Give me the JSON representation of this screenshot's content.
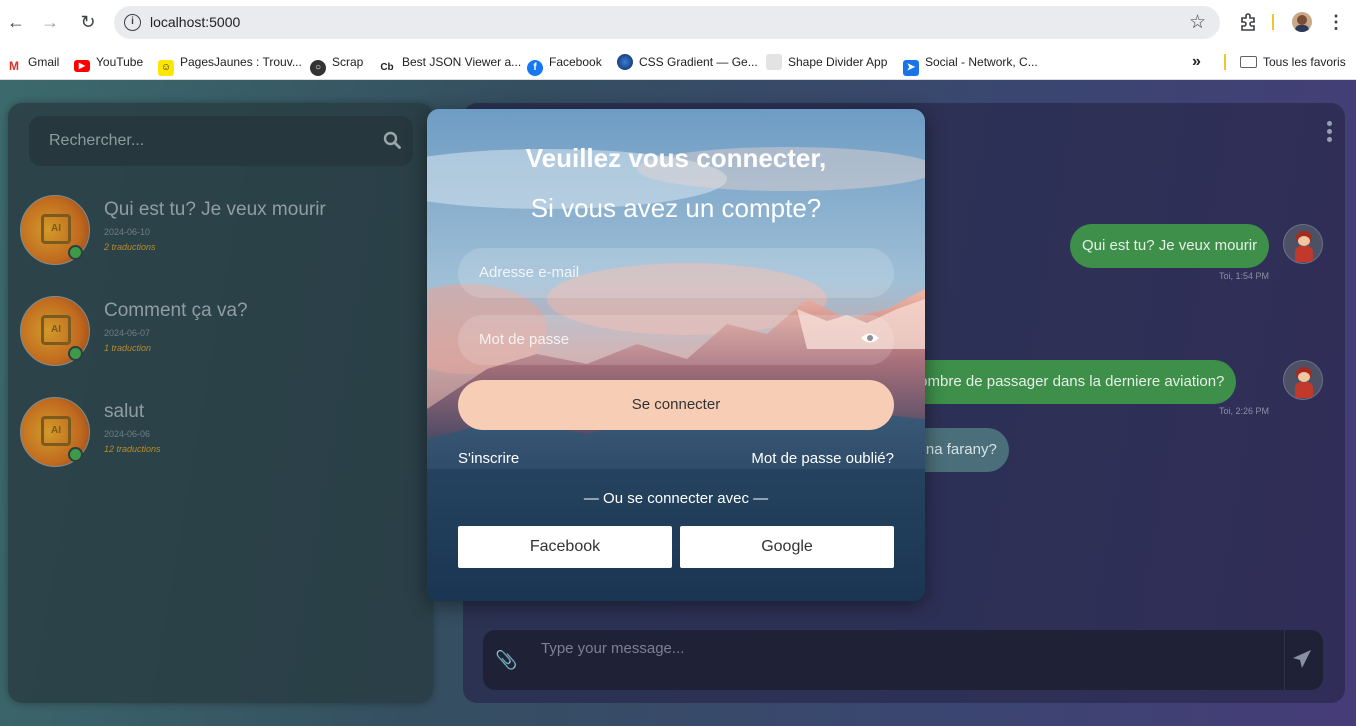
{
  "browser": {
    "url": "localhost:5000",
    "bookmarks": [
      {
        "label": "Gmail",
        "icon": "gmail-icon"
      },
      {
        "label": "YouTube",
        "icon": "youtube-icon"
      },
      {
        "label": "PagesJaunes : Trouv...",
        "icon": "pagesjaunes-icon"
      },
      {
        "label": "Scrap",
        "icon": "globe-icon"
      },
      {
        "label": "Best JSON Viewer a...",
        "icon": "cb-icon",
        "icon_text": "Cb"
      },
      {
        "label": "Facebook",
        "icon": "facebook-icon"
      },
      {
        "label": "CSS Gradient — Ge...",
        "icon": "cssgradient-icon"
      },
      {
        "label": "Shape Divider App",
        "icon": "shapedivider-icon"
      },
      {
        "label": "Social - Network, C...",
        "icon": "social-icon"
      }
    ],
    "all_bookmarks": "Tous les favoris"
  },
  "sidebar": {
    "search_placeholder": "Rechercher...",
    "conversations": [
      {
        "title": "Qui est tu? Je veux mourir",
        "date": "2024-06-10",
        "count": "2 traductions"
      },
      {
        "title": "Comment ça va?",
        "date": "2024-06-07",
        "count": "1 traduction"
      },
      {
        "title": "salut",
        "date": "2024-06-06",
        "count": "12 traductions"
      }
    ],
    "avatar_text": "AI"
  },
  "chat": {
    "messages": [
      {
        "text": "Qui est tu? Je veux mourir",
        "time": "Toi, 1:54 PM",
        "from": "me"
      },
      {
        "text": "le nombre de passager dans la derniere aviation?",
        "time": "Toi, 2:26 PM",
        "from": "me"
      },
      {
        "text": "Ohatrinona ny vidina farany?",
        "from": "other"
      }
    ],
    "composer_placeholder": "Type your message..."
  },
  "login": {
    "title": "Veuillez vous connecter,",
    "subtitle": "Si vous avez un compte?",
    "email_placeholder": "Adresse e-mail",
    "password_placeholder": "Mot de passe",
    "submit": "Se connecter",
    "signup": "S'inscrire",
    "forgot": "Mot de passe oublié?",
    "or": "— Ou se connecter avec —",
    "facebook": "Facebook",
    "google": "Google"
  },
  "colors": {
    "accent_peach": "#f7cdb5",
    "bubble_green": "#3e8f4a",
    "online_green": "#3e9a48"
  }
}
